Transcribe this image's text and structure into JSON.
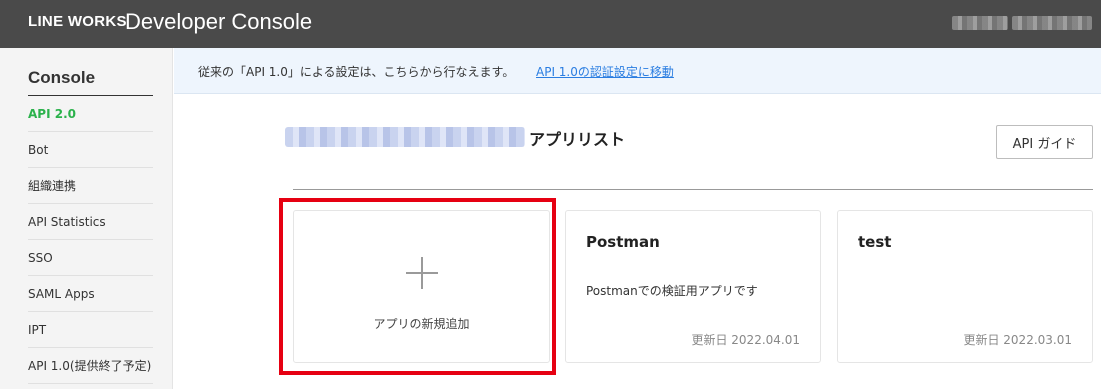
{
  "header": {
    "brand": "LINE WORKS",
    "title": "Developer Console"
  },
  "sidebar": {
    "title": "Console",
    "items": [
      {
        "label": "API 2.0",
        "active": true
      },
      {
        "label": "Bot"
      },
      {
        "label": "組織連携"
      },
      {
        "label": "API Statistics"
      },
      {
        "label": "SSO"
      },
      {
        "label": "SAML Apps"
      },
      {
        "label": "IPT"
      },
      {
        "label": "API 1.0(提供終了予定)"
      }
    ]
  },
  "notice": {
    "text": "従来の「API 1.0」による設定は、こちらから行なえます。",
    "link": "API 1.0の認証設定に移動"
  },
  "main": {
    "title": "アプリリスト",
    "guide_button": "API ガイド",
    "add_card_label": "アプリの新規追加",
    "apps": [
      {
        "name": "Postman",
        "description": "Postmanでの検証用アプリです",
        "updated": "更新日 2022.04.01"
      },
      {
        "name": "test",
        "description": "",
        "updated": "更新日 2022.03.01"
      }
    ]
  },
  "colors": {
    "header_bg": "#4a4a4a",
    "active_nav": "#2bb24c",
    "link": "#2a7de1",
    "highlight": "#e60012"
  }
}
